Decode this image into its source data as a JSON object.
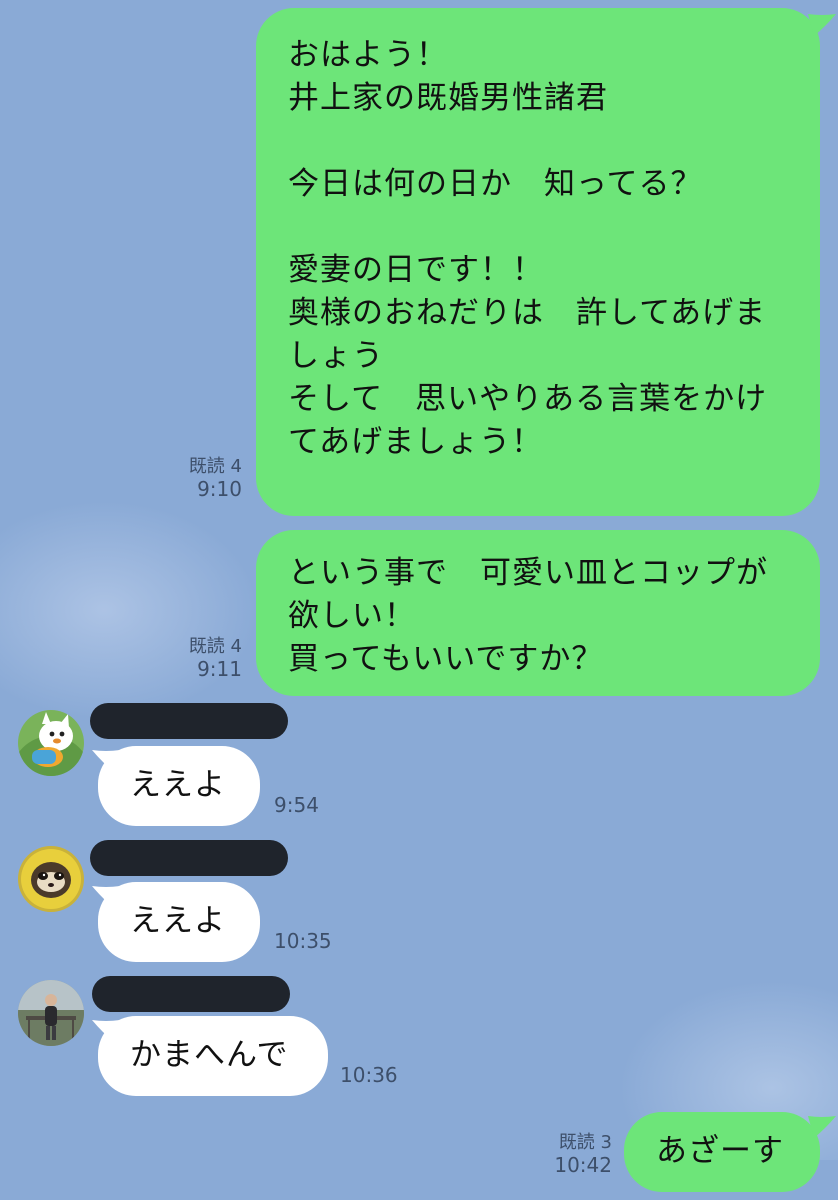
{
  "chat": {
    "outgoing": [
      {
        "text": "おはよう！\n井上家の既婚男性諸君\n\n今日は何の日か　知ってる？\n\n愛妻の日です！！\n奥様のおねだりは　許してあげま\nしょう\nそして　思いやりある言葉をかけ\nてあげましょう！",
        "read_label": "既読 4",
        "time": "9:10"
      },
      {
        "text": "という事で　可愛い皿とコップが\n欲しい！\n買ってもいいですか？",
        "read_label": "既読 4",
        "time": "9:11"
      },
      {
        "text": "あざーす",
        "read_label": "既読 3",
        "time": "10:42"
      }
    ],
    "incoming": [
      {
        "avatar_icon": "green-character-avatar-icon",
        "text": "ええよ",
        "time": "9:54"
      },
      {
        "avatar_icon": "ferret-avatar-icon",
        "text": "ええよ",
        "time": "10:35"
      },
      {
        "avatar_icon": "person-photo-avatar-icon",
        "text": "かまへんで",
        "time": "10:36"
      }
    ]
  },
  "colors": {
    "background": "#8aaad6",
    "outgoing_bubble": "#6de579",
    "incoming_bubble": "#ffffff",
    "name_redaction": "#1f242c"
  }
}
